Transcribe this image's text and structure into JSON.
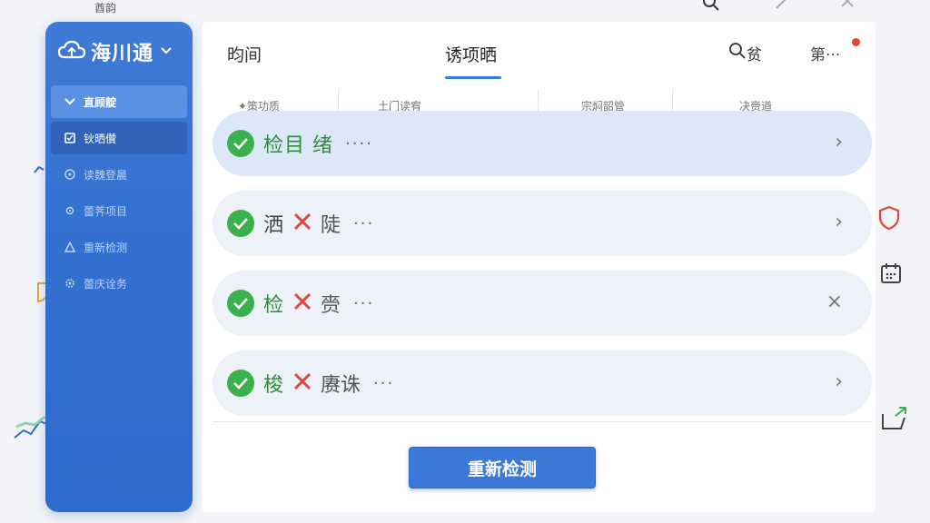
{
  "top": {
    "label": "酋韵"
  },
  "brand": {
    "name": "海川通"
  },
  "sidebar": {
    "items": [
      {
        "label": "直顾靛",
        "icon": "chevron-down-icon"
      },
      {
        "label": "钬晒儹",
        "icon": "shield-icon"
      },
      {
        "label": "读魏登晨",
        "icon": "clock-icon"
      },
      {
        "label": "蕾荠项目",
        "icon": "gear-icon"
      },
      {
        "label": "重新检测",
        "icon": "warning-icon"
      },
      {
        "label": "蕾庆诠务",
        "icon": "settings-icon"
      }
    ]
  },
  "tabs": {
    "t1": "昀间",
    "t2": "诱项晒",
    "search": "贫",
    "more": "第···"
  },
  "columns": [
    "✦策功质",
    "土门读宥",
    "宗焖韶管",
    "决赍遒"
  ],
  "rows": [
    {
      "a": "检目",
      "b": "绪",
      "dots": "····",
      "end": "›"
    },
    {
      "a": "洒",
      "b": "陡",
      "dots": "···",
      "end": "›"
    },
    {
      "a": "检",
      "b": "赍",
      "dots": "···",
      "end": "×"
    },
    {
      "a": "梭",
      "b": "赓诛",
      "dots": "···",
      "end": "›"
    }
  ],
  "button": {
    "recheck": "重新检测"
  },
  "colors": {
    "accent": "#3c78d8",
    "success": "#3bb14e",
    "error": "#e2453c"
  }
}
